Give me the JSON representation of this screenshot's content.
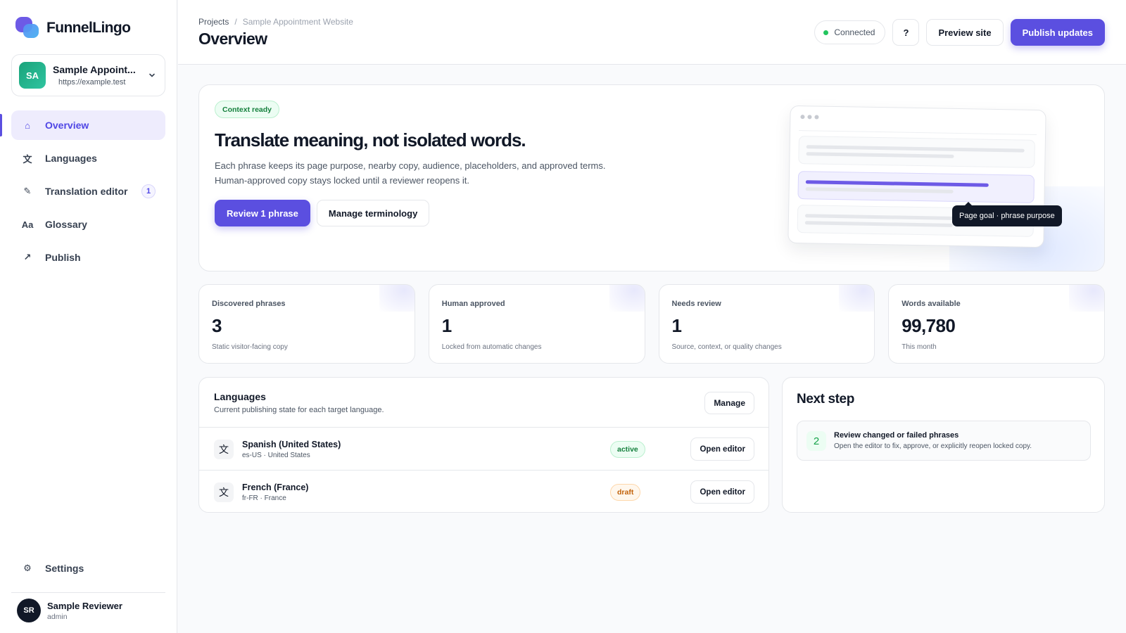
{
  "app": {
    "name": "FunnelLingo"
  },
  "project": {
    "initials": "SA",
    "name": "Sample Appoint...",
    "url": "https://example.test"
  },
  "nav": {
    "items": [
      {
        "label": "Overview",
        "icon": "⌂"
      },
      {
        "label": "Languages",
        "icon": "文"
      },
      {
        "label": "Translation editor",
        "icon": "✎",
        "badge": "1"
      },
      {
        "label": "Glossary",
        "icon": "Aa"
      },
      {
        "label": "Publish",
        "icon": "↗"
      }
    ],
    "settings": {
      "label": "Settings",
      "icon": "⚙"
    }
  },
  "user": {
    "initials": "SR",
    "name": "Sample Reviewer",
    "role": "admin"
  },
  "header": {
    "breadcrumb": [
      "Projects",
      "/",
      "Sample Appointment Website"
    ],
    "title": "Overview",
    "status": "Connected",
    "help": "?",
    "preview": "Preview site",
    "publish": "Publish updates"
  },
  "hero": {
    "badge": "Context ready",
    "title": "Translate meaning, not isolated words.",
    "desc_line1": "Each phrase keeps its page purpose, nearby copy, audience, placeholders, and approved terms.",
    "desc_line2": "Human-approved copy stays locked until a reviewer reopens it.",
    "primary_button": "Review 1 phrase",
    "secondary_button": "Manage terminology",
    "tooltip": "Page goal · phrase purpose"
  },
  "stats": [
    {
      "label": "Discovered phrases",
      "value": "3",
      "sub": "Static visitor-facing copy"
    },
    {
      "label": "Human approved",
      "value": "1",
      "sub": "Locked from automatic changes"
    },
    {
      "label": "Needs review",
      "value": "1",
      "sub": "Source, context, or quality changes"
    },
    {
      "label": "Words available",
      "value": "99,780",
      "sub": "This month"
    }
  ],
  "languages": {
    "title": "Languages",
    "subtitle": "Current publishing state for each target language.",
    "manage_button": "Manage",
    "rows": [
      {
        "icon": "文",
        "name": "Spanish (United States)",
        "meta": "es-US · United States",
        "status": "active",
        "action": "Open editor"
      },
      {
        "icon": "文",
        "name": "French (France)",
        "meta": "fr-FR · France",
        "status": "draft",
        "action": "Open editor"
      }
    ]
  },
  "next_step": {
    "title": "Next step",
    "number": "2",
    "heading": "Review changed or failed phrases",
    "desc": "Open the editor to fix, approve, or explicitly reopen locked copy."
  },
  "colors": {
    "accent": "#5b4fe0",
    "success": "#16a34a",
    "warning": "#c2620a",
    "text": "#111827"
  }
}
